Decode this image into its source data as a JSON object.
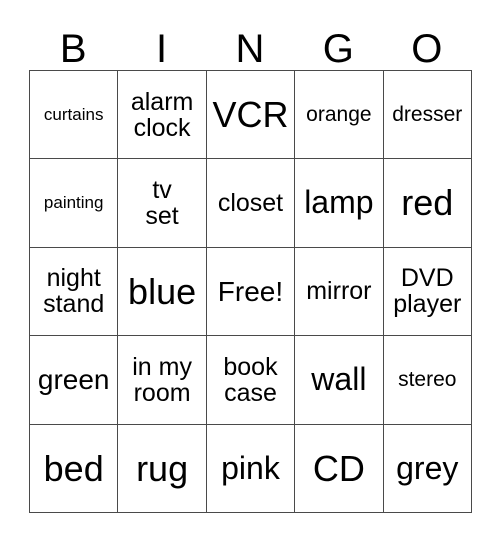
{
  "card": {
    "header": [
      "B",
      "I",
      "N",
      "G",
      "O"
    ],
    "rows": [
      [
        {
          "text": "curtains",
          "size": "fs-xs"
        },
        {
          "text": "alarm\nclock",
          "size": "fs-m"
        },
        {
          "text": "VCR",
          "size": "fs-xxl"
        },
        {
          "text": "orange",
          "size": "fs-s"
        },
        {
          "text": "dresser",
          "size": "fs-s"
        }
      ],
      [
        {
          "text": "painting",
          "size": "fs-xs"
        },
        {
          "text": "tv\nset",
          "size": "fs-m"
        },
        {
          "text": "closet",
          "size": "fs-m"
        },
        {
          "text": "lamp",
          "size": "fs-xl"
        },
        {
          "text": "red",
          "size": "fs-xxl"
        }
      ],
      [
        {
          "text": "night\nstand",
          "size": "fs-m"
        },
        {
          "text": "blue",
          "size": "fs-xxl"
        },
        {
          "text": "Free!",
          "size": "fs-l"
        },
        {
          "text": "mirror",
          "size": "fs-m"
        },
        {
          "text": "DVD\nplayer",
          "size": "fs-m"
        }
      ],
      [
        {
          "text": "green",
          "size": "fs-l"
        },
        {
          "text": "in my\nroom",
          "size": "fs-m"
        },
        {
          "text": "book\ncase",
          "size": "fs-m"
        },
        {
          "text": "wall",
          "size": "fs-xl"
        },
        {
          "text": "stereo",
          "size": "fs-s"
        }
      ],
      [
        {
          "text": "bed",
          "size": "fs-xxl"
        },
        {
          "text": "rug",
          "size": "fs-xxl"
        },
        {
          "text": "pink",
          "size": "fs-xl"
        },
        {
          "text": "CD",
          "size": "fs-xxl"
        },
        {
          "text": "grey",
          "size": "fs-xl"
        }
      ]
    ],
    "colors": {
      "background": "#ffffff",
      "text": "#000000",
      "grid_line": "#4a4a4a"
    }
  }
}
